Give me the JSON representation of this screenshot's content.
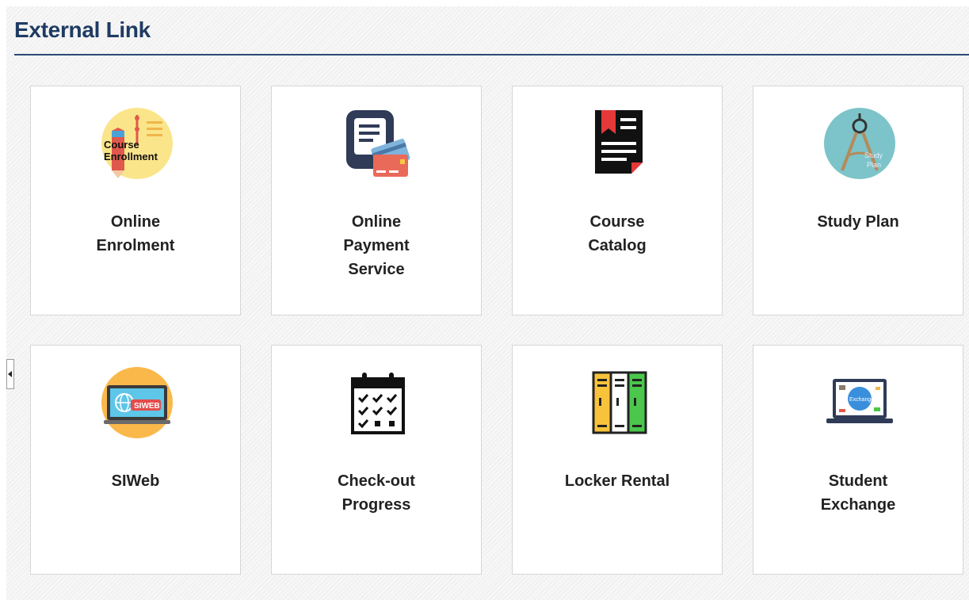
{
  "section": {
    "title": "External Link"
  },
  "tiles": [
    {
      "label": "Online Enrolment",
      "icon": "course-enrolment-icon",
      "icon_text": "Course Enrollment"
    },
    {
      "label": "Online Payment Service",
      "icon": "payment-card-icon"
    },
    {
      "label": "Course Catalog",
      "icon": "catalog-book-icon"
    },
    {
      "label": "Study Plan",
      "icon": "compass-study-plan-icon",
      "icon_text": "Study Plan"
    },
    {
      "label": "SIWeb",
      "icon": "siweb-laptop-icon",
      "icon_text": "SIWEB"
    },
    {
      "label": "Check-out Progress",
      "icon": "checklist-calendar-icon"
    },
    {
      "label": "Locker Rental",
      "icon": "locker-icon"
    },
    {
      "label": "Student Exchange",
      "icon": "exchange-laptop-icon",
      "icon_text": "Exchange"
    }
  ],
  "colors": {
    "title": "#1f3b63",
    "rule": "#2b4a74",
    "tile_border": "#d6d6d6"
  }
}
